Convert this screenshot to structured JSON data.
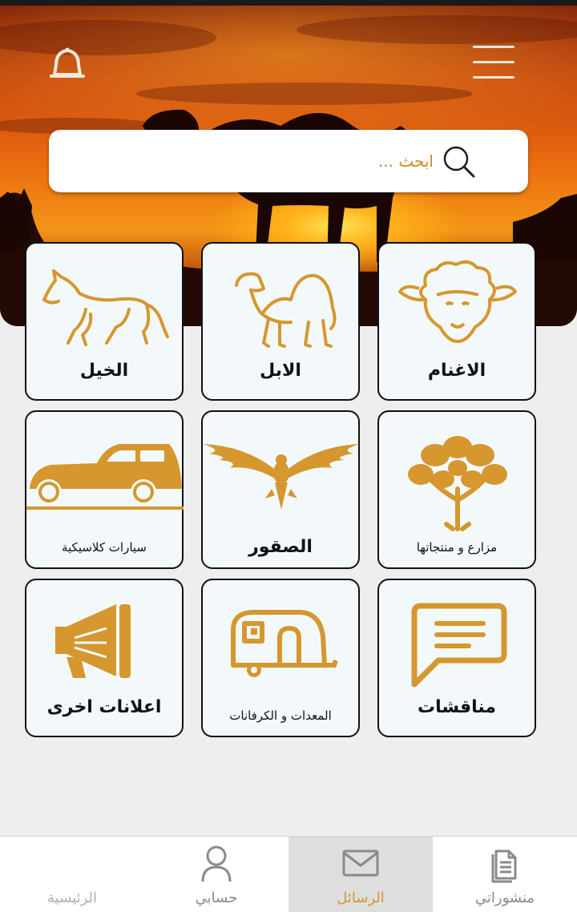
{
  "header": {
    "menu_icon": "hamburger-menu-icon",
    "notification_icon": "bell-icon"
  },
  "search": {
    "placeholder": "ابحث ...",
    "icon": "search-icon"
  },
  "categories": [
    {
      "label": "الاغنام",
      "icon": "sheep-icon"
    },
    {
      "label": "الابل",
      "icon": "camel-icon"
    },
    {
      "label": "الخيل",
      "icon": "horse-icon"
    },
    {
      "label": "مزارع و منتجاتها",
      "icon": "tree-icon"
    },
    {
      "label": "الصقور",
      "icon": "falcon-icon"
    },
    {
      "label": "سيارات كلاسيكية",
      "icon": "classic-car-icon"
    },
    {
      "label": "مناقشات",
      "icon": "chat-bubble-icon"
    },
    {
      "label": "المعدات و الكرفانات",
      "icon": "caravan-icon"
    },
    {
      "label": "اعلانات اخرى",
      "icon": "megaphone-icon"
    }
  ],
  "bottom_nav": [
    {
      "label": "منشوراتي",
      "icon": "documents-icon",
      "active": false
    },
    {
      "label": "الرسائل",
      "icon": "envelope-icon",
      "active": true
    },
    {
      "label": "حسابي",
      "icon": "user-icon",
      "active": false
    },
    {
      "label": "الرئيسية",
      "icon": "home-icon",
      "active": false
    }
  ],
  "colors": {
    "accent": "#d5972e",
    "tile_background": "#f3f9fb",
    "page_background": "#eeeeee"
  }
}
